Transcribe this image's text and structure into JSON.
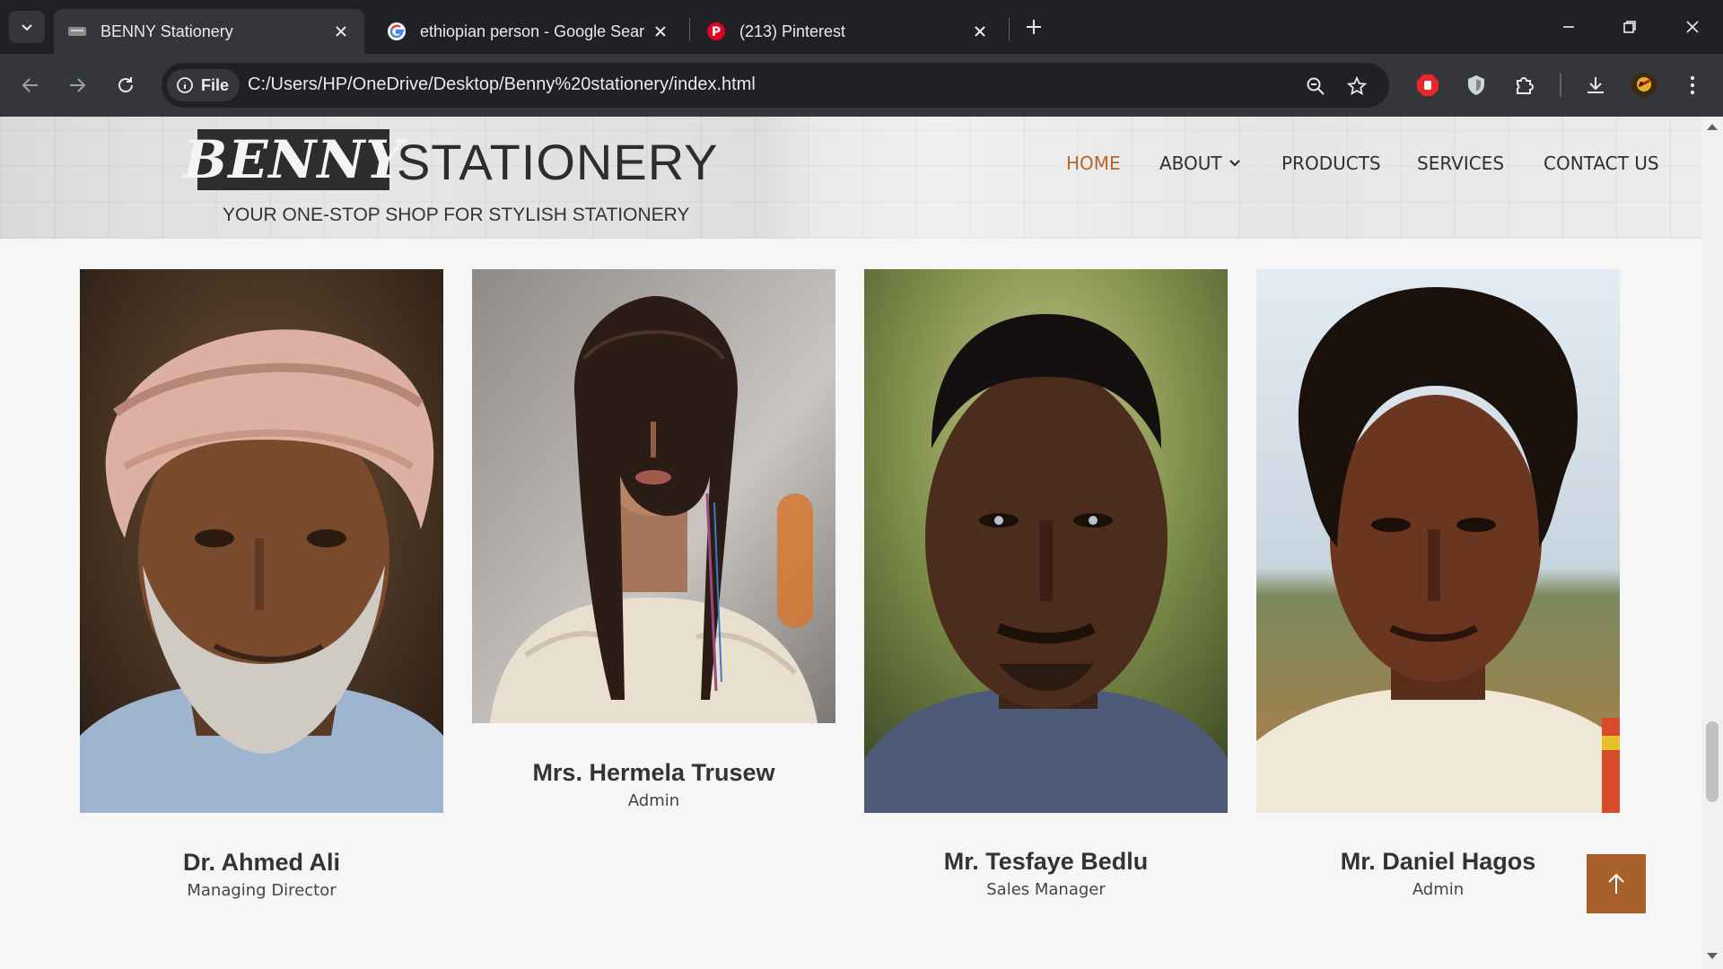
{
  "browser": {
    "tabs": [
      {
        "title": "BENNY Stationery",
        "favicon": "site-favicon",
        "active": true
      },
      {
        "title": "ethiopian person - Google Sear",
        "favicon": "google-icon",
        "active": false
      },
      {
        "title": "(213) Pinterest",
        "favicon": "pinterest-icon",
        "active": false
      }
    ],
    "address": {
      "chip_label": "File",
      "url": "C:/Users/HP/OneDrive/Desktop/Benny%20stationery/index.html"
    }
  },
  "site": {
    "logo_box_text": "BENNY",
    "logo_word": "STATIONERY",
    "tagline": "YOUR ONE-STOP SHOP FOR STYLISH STATIONERY",
    "nav": [
      {
        "label": "HOME",
        "active": true
      },
      {
        "label": "ABOUT",
        "has_dropdown": true
      },
      {
        "label": "PRODUCTS"
      },
      {
        "label": "SERVICES"
      },
      {
        "label": "CONTACT US"
      }
    ],
    "accent_color": "#b5672b"
  },
  "team": [
    {
      "name": "Dr. Ahmed Ali",
      "role": "Managing Director"
    },
    {
      "name": "Mrs. Hermela Trusew",
      "role": "Admin"
    },
    {
      "name": "Mr. Tesfaye Bedlu",
      "role": "Sales Manager"
    },
    {
      "name": "Mr. Daniel Hagos",
      "role": "Admin"
    }
  ],
  "back_to_top": {
    "icon": "arrow-up-icon",
    "color": "#a9612c"
  }
}
